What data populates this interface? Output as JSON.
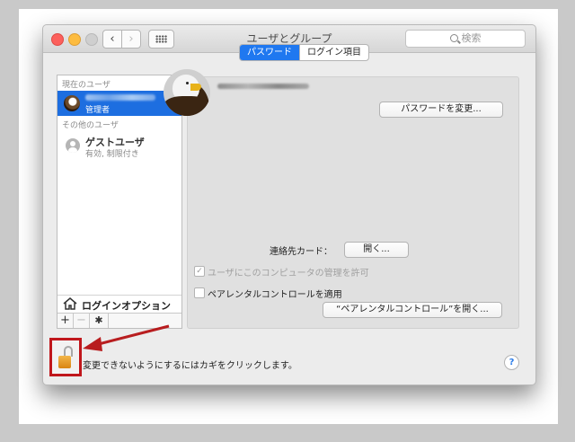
{
  "window": {
    "title": "ユーザとグループ",
    "search_placeholder": "検索"
  },
  "nav": {
    "back": "‹",
    "forward": "›"
  },
  "sidebar": {
    "current_users_header": "現在のユーザ",
    "current_user": {
      "role": "管理者"
    },
    "other_users_header": "その他のユーザ",
    "guest": {
      "name": "ゲストユーザ",
      "status": "有効, 制限付き"
    },
    "login_options": "ログインオプション",
    "buttons": {
      "add": "+",
      "remove": "−",
      "settings": "✱"
    }
  },
  "tabs": [
    {
      "label": "パスワード",
      "active": true
    },
    {
      "label": "ログイン項目",
      "active": false
    }
  ],
  "main": {
    "change_password_button": "パスワードを変更...",
    "contact_card_label": "連絡先カード：",
    "open_button": "開く...",
    "allow_admin_label": "ユーザにこのコンピュータの管理を許可",
    "allow_admin_checked": true,
    "parental_label": "ペアレンタルコントロールを適用",
    "parental_checked": false,
    "open_parental_button": "“ペアレンタルコントロール”を開く..."
  },
  "bottom": {
    "lock_text": "変更できないようにするにはカギをクリックします。",
    "help": "?"
  },
  "colors": {
    "accent": "#1f78f0",
    "highlight": "#c0171c",
    "lock": "#e69a22"
  }
}
